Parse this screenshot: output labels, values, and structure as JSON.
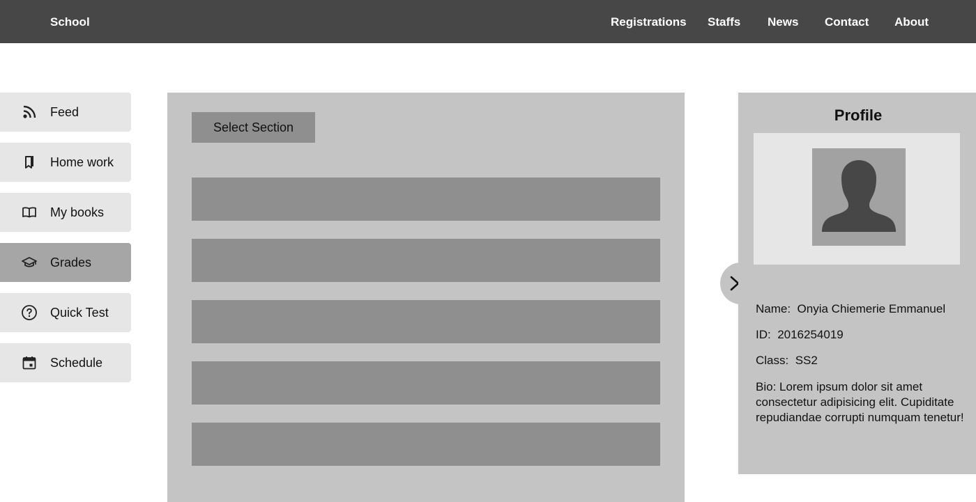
{
  "header": {
    "brand": "School",
    "nav": [
      "Registrations",
      "Staffs",
      "News",
      "Contact",
      "About"
    ]
  },
  "sidebar": {
    "items": [
      {
        "label": "Feed",
        "icon": "rss-icon"
      },
      {
        "label": "Home work",
        "icon": "bookmark-icon"
      },
      {
        "label": "My books",
        "icon": "book-icon"
      },
      {
        "label": "Grades",
        "icon": "graduation-cap-icon",
        "active": true
      },
      {
        "label": "Quick Test",
        "icon": "question-circle-icon"
      },
      {
        "label": "Schedule",
        "icon": "calendar-icon"
      }
    ]
  },
  "main": {
    "select_label": "Select Section",
    "row_count": 5
  },
  "profile": {
    "title": "Profile",
    "name_label": "Name:",
    "name": "Onyia Chiemerie Emmanuel",
    "id_label": "ID:",
    "id": "2016254019",
    "class_label": "Class:",
    "class": "SS2",
    "bio_label": "Bio:",
    "bio": "Lorem ipsum dolor sit amet consectetur adipisicing elit. Cupiditate repudiandae corrupti numquam tenetur!"
  },
  "colors": {
    "topbar": "#474747",
    "panel": "#c4c4c4",
    "row": "#8f8f8f",
    "sidebar_item": "#e6e6e6",
    "sidebar_active": "#a6a6a6"
  }
}
